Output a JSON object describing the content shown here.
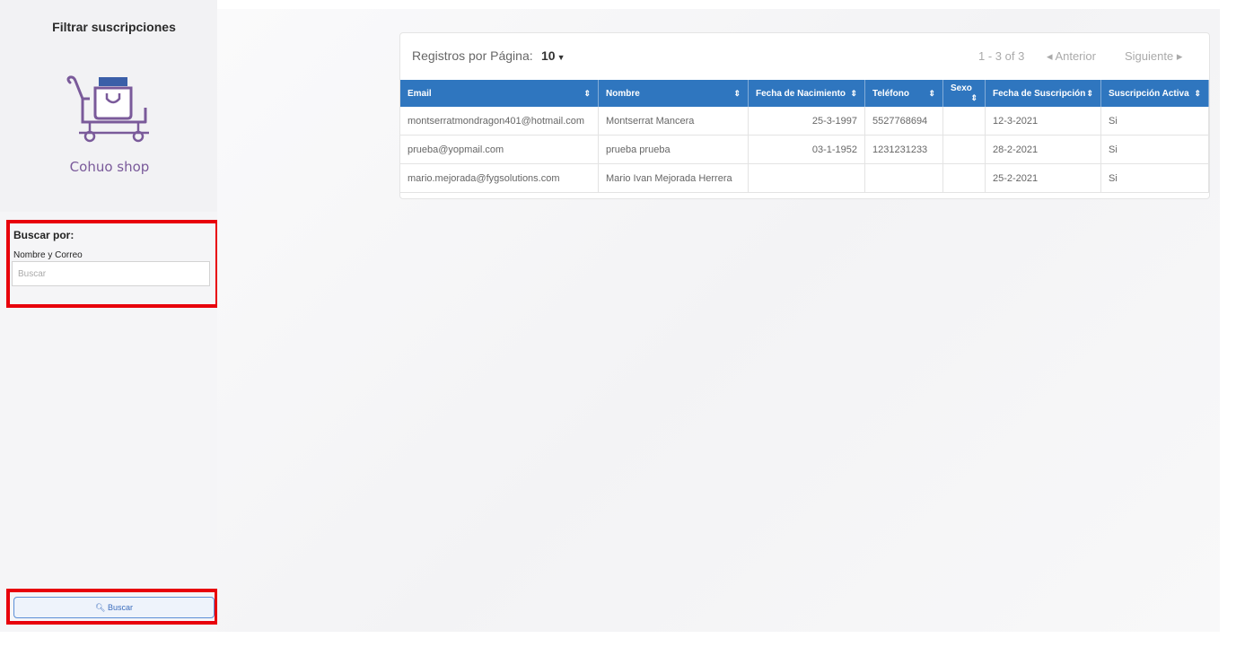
{
  "sidebar": {
    "title": "Filtrar suscripciones",
    "logo_text": "Cohuo shop",
    "search_heading": "Buscar por:",
    "search_field_label": "Nombre y Correo",
    "search_placeholder": "Buscar",
    "search_button_label": "Buscar"
  },
  "table_controls": {
    "per_page_label": "Registros por Página:",
    "per_page_value": "10",
    "range": "1 - 3 of 3",
    "prev_label": "Anterior",
    "next_label": "Siguiente"
  },
  "table": {
    "headers": [
      "Email",
      "Nombre",
      "Fecha de Nacimiento",
      "Teléfono",
      "Sexo",
      "Fecha de Suscripción",
      "Suscripción Activa"
    ],
    "rows": [
      [
        "montserratmondragon401@hotmail.com",
        "Montserrat Mancera",
        "25-3-1997",
        "5527768694",
        "",
        "12-3-2021",
        "Si"
      ],
      [
        "prueba@yopmail.com",
        "prueba prueba",
        "03-1-1952",
        "1231231233",
        "",
        "28-2-2021",
        "Si"
      ],
      [
        "mario.mejorada@fygsolutions.com",
        "Mario Ivan Mejorada Herrera",
        "",
        "",
        "",
        "25-2-2021",
        "Si"
      ]
    ]
  },
  "colors": {
    "header_blue": "#2f76bf",
    "highlight_red": "#e8000b",
    "logo_purple": "#7a5a9a"
  },
  "icons": [
    "cart-icon",
    "shopping-bag-icon",
    "search-icon",
    "sort-icon",
    "chevron-left-icon",
    "chevron-right-icon",
    "caret-down-icon"
  ]
}
